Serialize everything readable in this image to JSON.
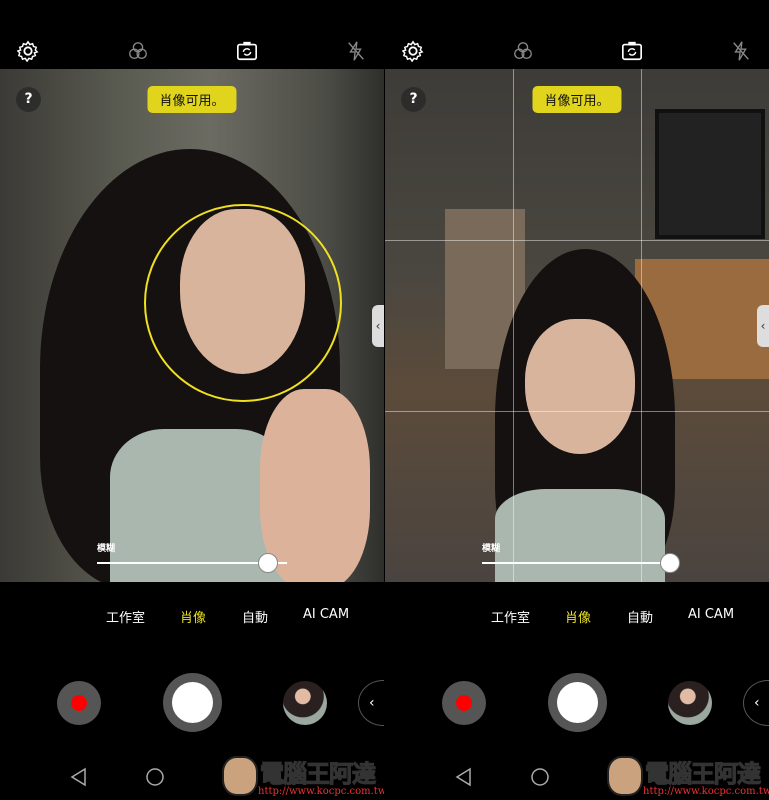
{
  "panels": [
    {
      "top_icons": [
        "gear-icon",
        "filter-icon",
        "switch-camera-icon",
        "flash-off-icon"
      ],
      "help": "?",
      "badge": "肖像可用。",
      "blur_label": "模糊",
      "blur_level": 0.9,
      "modes": [
        {
          "label": "工作室",
          "active": false
        },
        {
          "label": "肖像",
          "active": true
        },
        {
          "label": "自動",
          "active": false
        },
        {
          "label": "AI CAM",
          "active": false
        }
      ],
      "side_tab": "‹",
      "more": "‹",
      "face_detected": true,
      "grid": false
    },
    {
      "top_icons": [
        "gear-icon",
        "filter-icon",
        "switch-camera-icon",
        "flash-off-icon"
      ],
      "help": "?",
      "badge": "肖像可用。",
      "blur_label": "模糊",
      "blur_level": 0.99,
      "modes": [
        {
          "label": "工作室",
          "active": false
        },
        {
          "label": "肖像",
          "active": true
        },
        {
          "label": "自動",
          "active": false
        },
        {
          "label": "AI CAM",
          "active": false
        }
      ],
      "side_tab": "‹",
      "more": "‹",
      "face_detected": false,
      "grid": true
    }
  ],
  "colors": {
    "accent": "#e1d41c",
    "record": "#ff0000"
  },
  "watermark": {
    "title": "電腦王阿達",
    "url": "http://www.kocpc.com.tw"
  }
}
